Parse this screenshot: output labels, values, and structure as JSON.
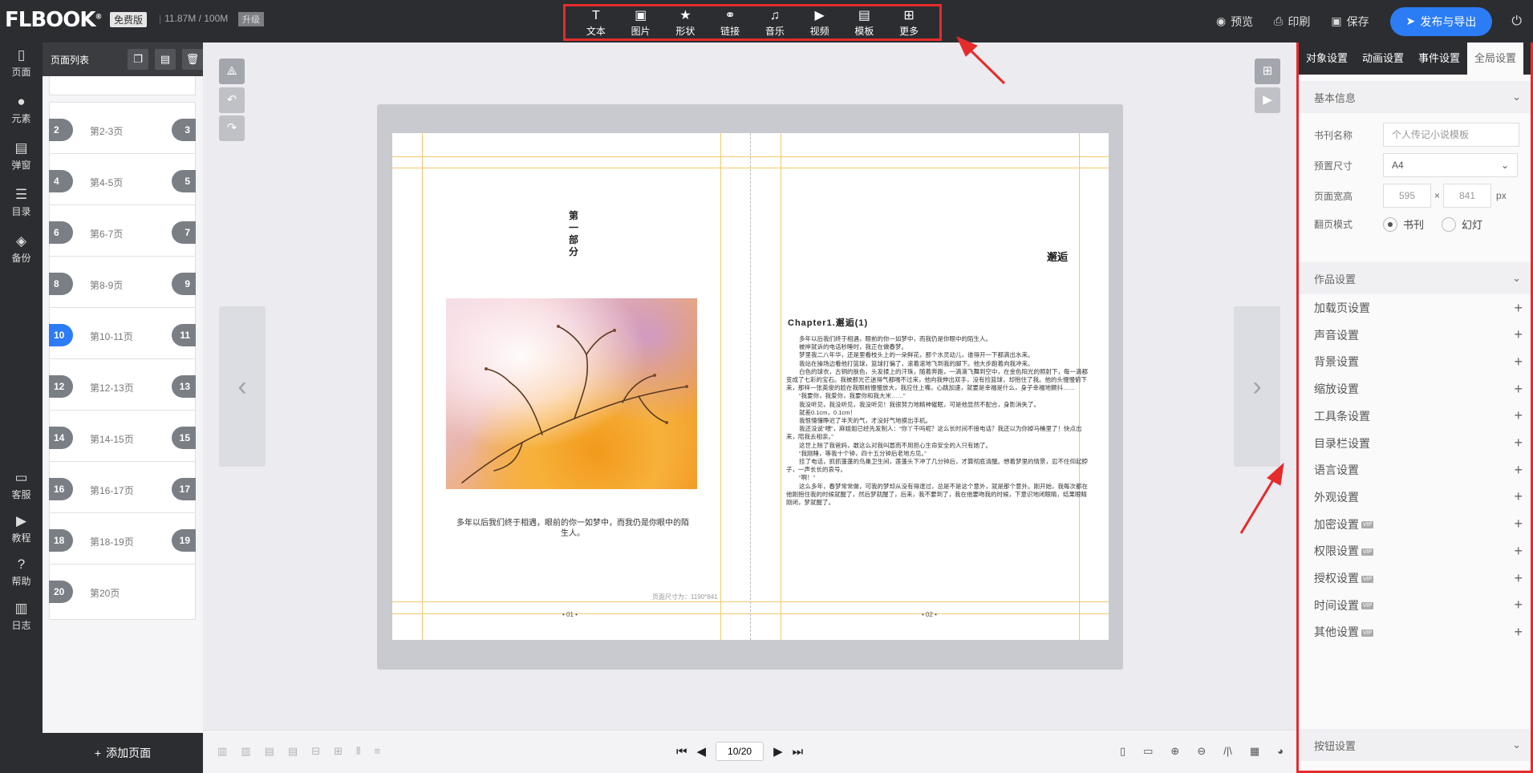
{
  "header": {
    "logo": "FLBOOK",
    "logo_mark": "®",
    "edition": "免费版",
    "storage": "11.87M / 100M",
    "upgrade": "升级"
  },
  "toolbar": {
    "items": [
      {
        "label": "文本",
        "icon": "text-icon",
        "glyph": "T"
      },
      {
        "label": "图片",
        "icon": "image-icon",
        "glyph": "▣"
      },
      {
        "label": "形状",
        "icon": "star-icon",
        "glyph": "★"
      },
      {
        "label": "链接",
        "icon": "link-icon",
        "glyph": "⚭"
      },
      {
        "label": "音乐",
        "icon": "music-icon",
        "glyph": "♫"
      },
      {
        "label": "视频",
        "icon": "video-icon",
        "glyph": "▶"
      },
      {
        "label": "模板",
        "icon": "template-icon",
        "glyph": "▤"
      },
      {
        "label": "更多",
        "icon": "more-icon",
        "glyph": "⊞"
      }
    ]
  },
  "actions": {
    "preview": "预览",
    "print": "印刷",
    "save": "保存",
    "publish": "发布与导出"
  },
  "leftnav": [
    {
      "label": "页面",
      "icon": "page-icon",
      "glyph": "▯"
    },
    {
      "label": "元素",
      "icon": "element-icon",
      "glyph": "●"
    },
    {
      "label": "弹窗",
      "icon": "popup-icon",
      "glyph": "▤"
    },
    {
      "label": "目录",
      "icon": "catalog-icon",
      "glyph": "☰"
    },
    {
      "label": "备份",
      "icon": "backup-icon",
      "glyph": "◈"
    },
    {
      "label": "客服",
      "icon": "service-icon",
      "glyph": "▭"
    },
    {
      "label": "教程",
      "icon": "tutorial-icon",
      "glyph": "▶"
    },
    {
      "label": "帮助",
      "icon": "help-icon",
      "glyph": "?"
    },
    {
      "label": "日志",
      "icon": "log-icon",
      "glyph": "▥"
    }
  ],
  "pagelist": {
    "title": "页面列表",
    "add_page": "添加页面",
    "items": [
      {
        "left": "2",
        "right": "3",
        "label": "第2-3页",
        "active": false
      },
      {
        "left": "4",
        "right": "5",
        "label": "第4-5页",
        "active": false
      },
      {
        "left": "6",
        "right": "7",
        "label": "第6-7页",
        "active": false
      },
      {
        "left": "8",
        "right": "9",
        "label": "第8-9页",
        "active": false
      },
      {
        "left": "10",
        "right": "11",
        "label": "第10-11页",
        "active": true
      },
      {
        "left": "12",
        "right": "13",
        "label": "第12-13页",
        "active": false
      },
      {
        "left": "14",
        "right": "15",
        "label": "第14-15页",
        "active": false
      },
      {
        "left": "16",
        "right": "17",
        "label": "第16-17页",
        "active": false
      },
      {
        "left": "18",
        "right": "19",
        "label": "第18-19页",
        "active": false
      },
      {
        "left": "20",
        "right": "",
        "label": "第20页",
        "active": false
      }
    ]
  },
  "book": {
    "part_title": "第一部分",
    "caption": "多年以后我们终于相遇，眼前的你一如梦中，而我仍是你眼中的陌生人。",
    "page_left": "• 01 •",
    "page_right": "• 02 •",
    "right_title": "邂逅",
    "chapter": "Chapter1.邂逅(1)",
    "body": [
      "多年以后我们终于相遇，眼前的你一如梦中，而我仍是你眼中的陌生人。",
      "被岸就诉的电话秒睡时，我正在做春梦。",
      "梦里我二八年华，还是里看枝头上的一朵鲜花，那个水灵动儿，谁得开一下都滴出水来。",
      "我站在操场边看他打篮球，篮球打偏了，滚着滚地飞到我的脚下。他大步跑着向我冲来。",
      "白色的球衣，古铜的肤色，头发揉上的汗珠，随着奔跑，一滴滴飞舞到空中，在金色阳光的照射下，每一滴都变成了七彩的宝石。我被那光芒迷得气都喘不过来，他向我伸出双手，没有捡篮球，却抱住了我。他的头慢慢俯下来，那样一张英俊的脸在我眼前慢慢放大，我应住上嘴，心跳加速，就要是幸福是什么，身子幸福地颤抖……",
      "“我要你，我爱你，我要你和我大米……”",
      "我没听见，我没听见，我没听见！我很努力地精神催眠，可是他显然不配合，身影消失了。",
      "就差0.1cm，0.1cm！",
      "我恨懵懂睁迟了半天的气，才没好气地摸出手机。",
      "我还没说“喂”，麻姐姐已经先发制人：“你丫干吗呢？这么长时间不接电话？我还以为你掉马桶里了！快点出来，陪我去相亲。”",
      "这世上除了我爸妈，敢这么对我叫嚣而不用担心生命安全的人只有她了。",
      "“我刚睡，等我十个钟，四十五分钟后老地方见。”",
      "挂了电话，抓抓蓬蓬的鸟巢卫生间，莲蓬头下冲了几分钟后，才算彻底清醒。想着梦里的情景，忍不住仰起脖子，一声长长的哀号。",
      "“啊！”",
      "这么多年，春梦常常做，可我的梦却从没有得逞过，总是不是这个意外，就是那个意外。刚开始，我每次都在他刚抱住我的时候就醒了，然后梦就醒了，后来，我不要到了，我在他要吻我的时候，下意识地闭眼睛，结果眼睛刚闭，梦就醒了。"
    ],
    "page_size": "页面尺寸为：1190*841"
  },
  "bottombar": {
    "current_page": "10/20"
  },
  "rightpanel": {
    "tabs": [
      "对象设置",
      "动画设置",
      "事件设置",
      "全局设置"
    ],
    "active_tab": 3,
    "basic_info": "基本信息",
    "fields": {
      "book_name_label": "书刊名称",
      "book_name_placeholder": "个人传记小说模板",
      "preset_label": "预置尺寸",
      "preset_value": "A4",
      "size_label": "页面宽高",
      "width": "595",
      "times": "×",
      "height": "841",
      "unit": "px",
      "flip_label": "翻页模式",
      "flip_book": "书刊",
      "flip_slide": "幻灯"
    },
    "work_settings": "作品设置",
    "settings": [
      {
        "label": "加载页设置",
        "vip": false
      },
      {
        "label": "声音设置",
        "vip": false
      },
      {
        "label": "背景设置",
        "vip": false
      },
      {
        "label": "缩放设置",
        "vip": false
      },
      {
        "label": "工具条设置",
        "vip": false
      },
      {
        "label": "目录栏设置",
        "vip": false
      },
      {
        "label": "语言设置",
        "vip": false
      },
      {
        "label": "外观设置",
        "vip": false
      },
      {
        "label": "加密设置",
        "vip": true
      },
      {
        "label": "权限设置",
        "vip": true
      },
      {
        "label": "授权设置",
        "vip": true
      },
      {
        "label": "时间设置",
        "vip": true
      },
      {
        "label": "其他设置",
        "vip": true
      }
    ],
    "vip_badge": "VIP",
    "button_settings": "按钮设置"
  },
  "colors": {
    "accent": "#2c7cf6",
    "highlight_border": "#e62b2b",
    "dark_bg": "#2b2d31"
  }
}
